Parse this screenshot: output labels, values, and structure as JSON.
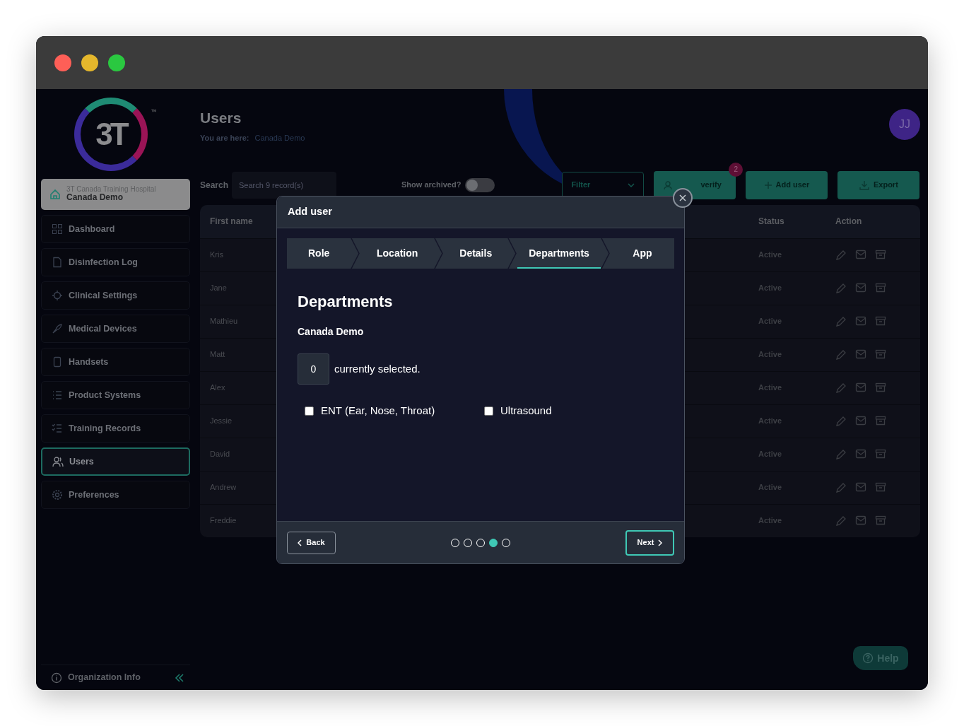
{
  "logo": {
    "text": "3T",
    "mark": "™"
  },
  "sidebar": {
    "org": {
      "hospital": "3T Canada Training Hospital",
      "name": "Canada Demo"
    },
    "items": [
      {
        "label": "Dashboard",
        "selected": false
      },
      {
        "label": "Disinfection Log",
        "selected": false
      },
      {
        "label": "Clinical Settings",
        "selected": false
      },
      {
        "label": "Medical Devices",
        "selected": false
      },
      {
        "label": "Handsets",
        "selected": false
      },
      {
        "label": "Product Systems",
        "selected": false
      },
      {
        "label": "Training Records",
        "selected": false
      },
      {
        "label": "Users",
        "selected": true
      },
      {
        "label": "Preferences",
        "selected": false
      }
    ],
    "footer": "Organization Info"
  },
  "header": {
    "title": "Users",
    "breadcrumb_label": "You are here:",
    "breadcrumb": "Canada Demo",
    "avatar": "JJ"
  },
  "toolbar": {
    "search_label": "Search",
    "search_placeholder": "Search 9 record(s)",
    "archived_label": "Show archived?",
    "archived_on": false,
    "filter": "Filter",
    "verify": "verify",
    "verify_badge": "2",
    "add": "Add user",
    "export": "Export"
  },
  "table": {
    "columns": [
      "First name",
      "Status",
      "Action"
    ],
    "rows": [
      {
        "first_name": "Kris",
        "status": "Active"
      },
      {
        "first_name": "Jane",
        "status": "Active"
      },
      {
        "first_name": "Mathieu",
        "status": "Active"
      },
      {
        "first_name": "Matt",
        "status": "Active"
      },
      {
        "first_name": "Alex",
        "status": "Active"
      },
      {
        "first_name": "Jessie",
        "status": "Active"
      },
      {
        "first_name": "David",
        "status": "Active"
      },
      {
        "first_name": "Andrew",
        "status": "Active"
      },
      {
        "first_name": "Freddie",
        "status": "Active"
      }
    ]
  },
  "modal": {
    "title": "Add user",
    "steps": [
      {
        "label": "Role",
        "selected": false
      },
      {
        "label": "Location",
        "selected": false
      },
      {
        "label": "Details",
        "selected": false
      },
      {
        "label": "Departments",
        "selected": true
      },
      {
        "label": "App",
        "selected": false
      }
    ],
    "heading": "Departments",
    "subheading": "Canada Demo",
    "count": "0",
    "count_text": "currently selected.",
    "departments": [
      {
        "label": "ENT (Ear, Nose, Throat)",
        "checked": false
      },
      {
        "label": "Ultrasound",
        "checked": false
      }
    ],
    "back": "Back",
    "next": "Next",
    "pages": [
      {
        "selected": false
      },
      {
        "selected": false
      },
      {
        "selected": false
      },
      {
        "selected": true
      },
      {
        "selected": false
      }
    ]
  },
  "help": "Help"
}
